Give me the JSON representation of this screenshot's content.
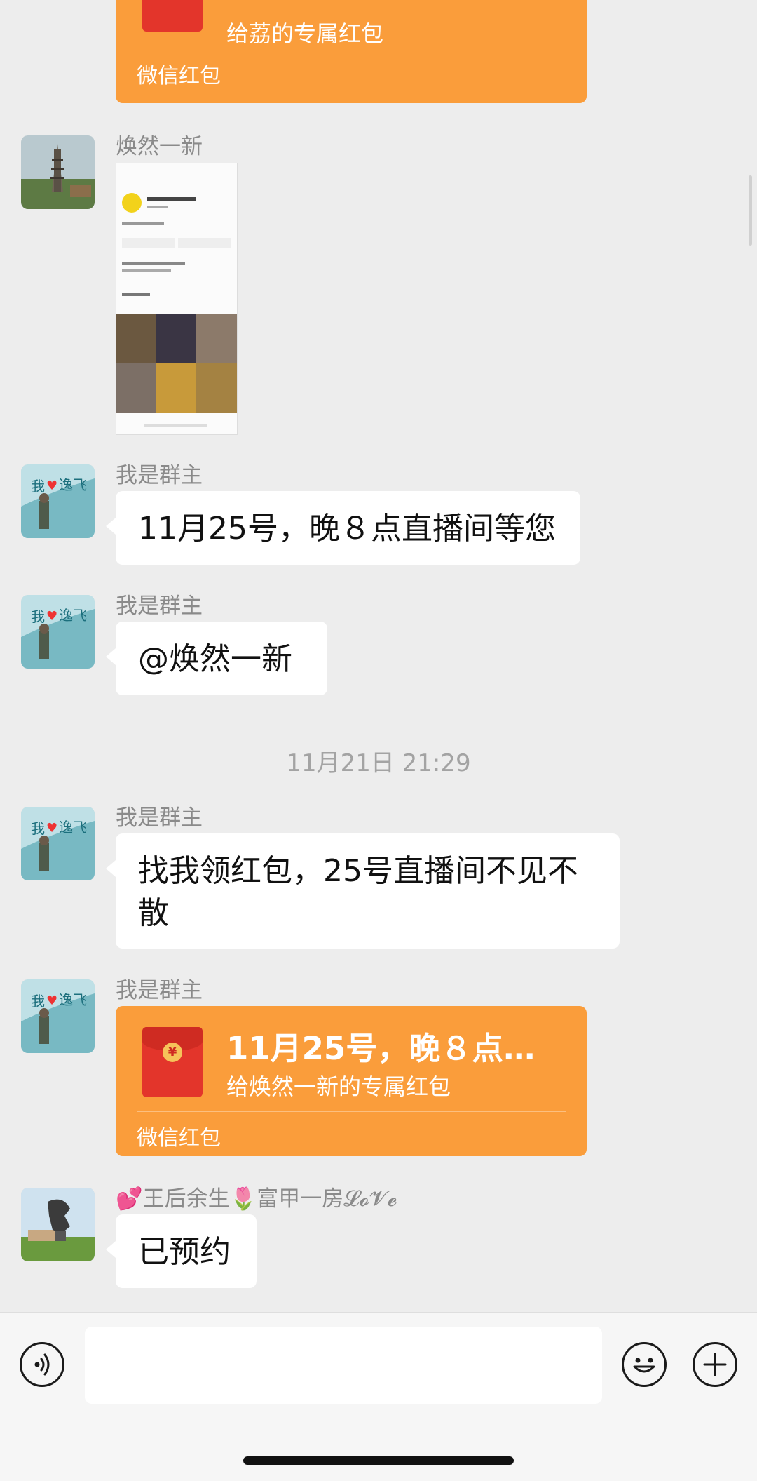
{
  "messages": {
    "m0": {
      "title": "",
      "subtitle": "给荔的专属红包",
      "footer": "微信红包"
    },
    "m1": {
      "sender": "焕然一新"
    },
    "m2": {
      "sender": "我是群主",
      "text": "11月25号，晚８点直播间等您"
    },
    "m3": {
      "sender": "我是群主",
      "text": "@焕然一新"
    },
    "timestamp": "11月21日 21:29",
    "m4": {
      "sender": "我是群主",
      "text": "找我领红包，25号直播间不见不散"
    },
    "m5": {
      "sender": "我是群主",
      "title": "11月25号，晚８点直…",
      "subtitle": "给焕然一新的专属红包",
      "footer": "微信红包"
    },
    "m6": {
      "sender": "💕王后余生🌷富甲一房𝓛𝓸𝓥𝓮",
      "text": "已预约"
    }
  },
  "composer": {
    "input_value": ""
  },
  "colors": {
    "red_packet": "#fa9d3b",
    "background": "#ededed",
    "bubble": "#ffffff"
  },
  "icons": [
    "voice-icon",
    "emoji-icon",
    "plus-icon",
    "red-envelope-icon"
  ]
}
